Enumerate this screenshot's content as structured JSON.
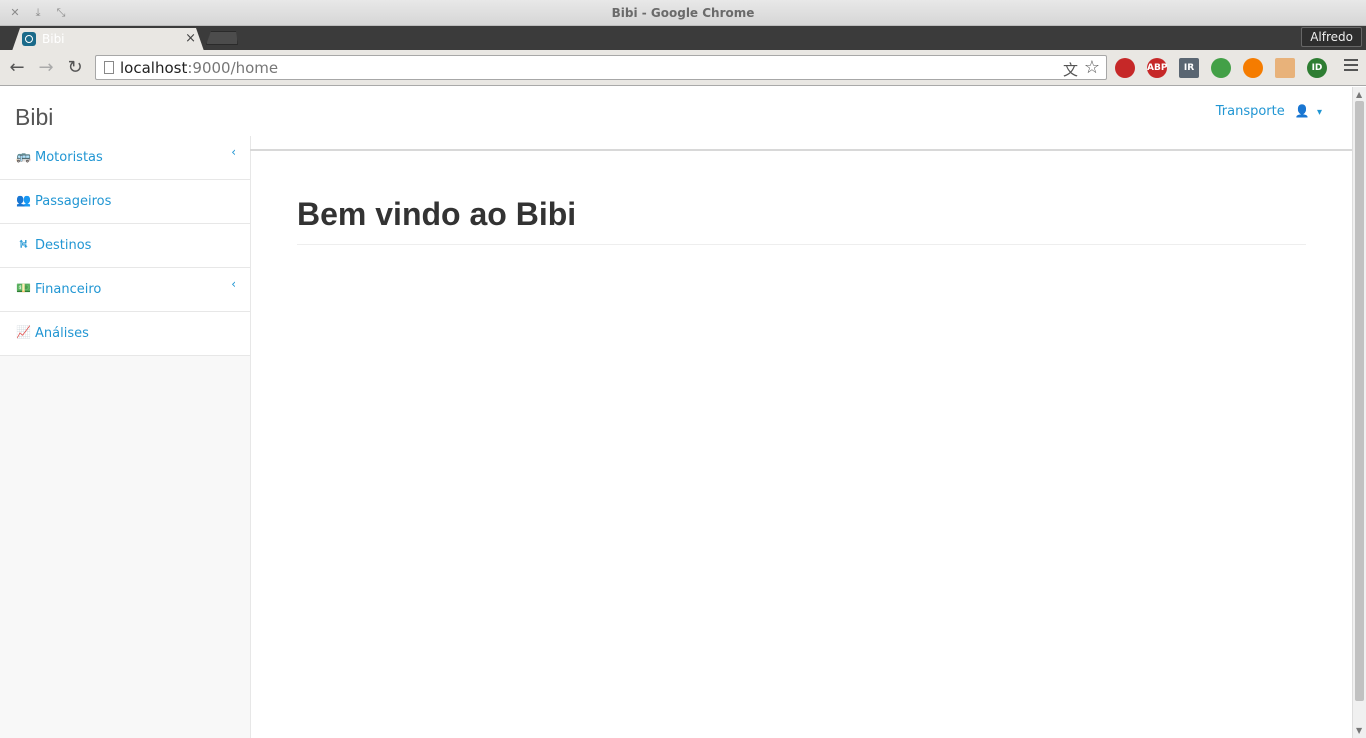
{
  "window": {
    "title": "Bibi - Google Chrome",
    "close_glyph": "✕",
    "minimize_glyph": "⤓",
    "restore_glyph": "⤡"
  },
  "tabs": {
    "active_label": "Bibi",
    "close_glyph": "×",
    "profile_name": "Alfredo"
  },
  "toolbar": {
    "back_glyph": "←",
    "forward_glyph": "→",
    "reload_glyph": "↻",
    "url_host": "localhost",
    "url_rest": ":9000/home",
    "translate_glyph": "文",
    "star_glyph": "☆",
    "extensions": [
      {
        "name": "ext-red-icon",
        "text": "",
        "color": "#c62828"
      },
      {
        "name": "adblock-icon",
        "text": "ABP",
        "color": "#c62828"
      },
      {
        "name": "ir-icon",
        "text": "IR",
        "color": "#5a6672"
      },
      {
        "name": "leaf-icon",
        "text": "",
        "color": "#43a047"
      },
      {
        "name": "circle-icon",
        "text": "",
        "color": "#f57c00"
      },
      {
        "name": "face-icon",
        "text": "",
        "color": "#e8b27a"
      },
      {
        "name": "id-icon",
        "text": "ID",
        "color": "#2e7d32"
      }
    ]
  },
  "app": {
    "brand": "Bibi",
    "user_menu": {
      "label": "Transporte",
      "icon": "user-icon",
      "icon_glyph": "👤",
      "caret_glyph": "▾"
    },
    "sidebar": {
      "items": [
        {
          "label": "Motoristas",
          "icon": "bus-icon",
          "glyph": "🚌",
          "has_submenu": true
        },
        {
          "label": "Passageiros",
          "icon": "users-icon",
          "glyph": "👥",
          "has_submenu": false
        },
        {
          "label": "Destinos",
          "icon": "road-icon",
          "glyph": "⛕",
          "has_submenu": false
        },
        {
          "label": "Financeiro",
          "icon": "money-icon",
          "glyph": "💵",
          "has_submenu": true
        },
        {
          "label": "Análises",
          "icon": "line-chart-icon",
          "glyph": "📈",
          "has_submenu": false
        }
      ],
      "chevron_glyph": "‹"
    },
    "heading": "Bem vindo ao Bibi"
  },
  "colors": {
    "link": "#2196d3",
    "sidebar_bg": "#f8f8f8"
  }
}
